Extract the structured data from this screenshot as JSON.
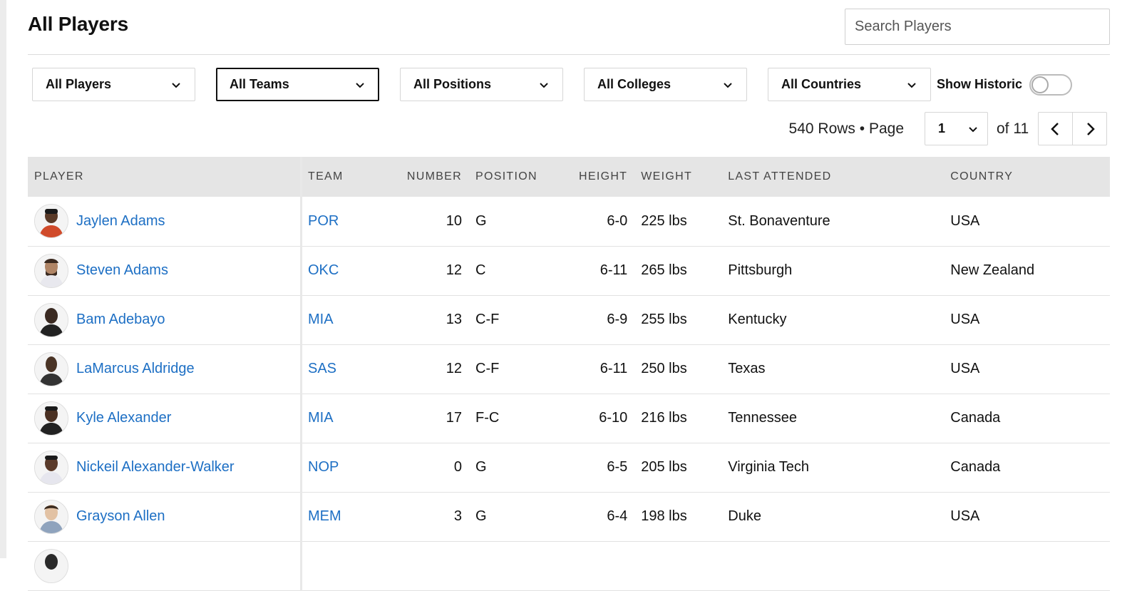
{
  "title": "All Players",
  "search": {
    "placeholder": "Search Players"
  },
  "filters": [
    {
      "label": "All Players",
      "active": false
    },
    {
      "label": "All Teams",
      "active": true
    },
    {
      "label": "All Positions",
      "active": false
    },
    {
      "label": "All Colleges",
      "active": false
    },
    {
      "label": "All Countries",
      "active": false
    }
  ],
  "historic": {
    "label": "Show Historic",
    "on": false
  },
  "pagination": {
    "rows_label": "540 Rows • Page",
    "current_page": "1",
    "of_label": "of 11"
  },
  "table": {
    "columns": [
      "PLAYER",
      "TEAM",
      "NUMBER",
      "POSITION",
      "HEIGHT",
      "WEIGHT",
      "LAST ATTENDED",
      "COUNTRY"
    ],
    "rows": [
      {
        "player": "Jaylen Adams",
        "team": "POR",
        "number": "10",
        "position": "G",
        "height": "6-0",
        "weight": "225 lbs",
        "last_attended": "St. Bonaventure",
        "country": "USA"
      },
      {
        "player": "Steven Adams",
        "team": "OKC",
        "number": "12",
        "position": "C",
        "height": "6-11",
        "weight": "265 lbs",
        "last_attended": "Pittsburgh",
        "country": "New Zealand"
      },
      {
        "player": "Bam Adebayo",
        "team": "MIA",
        "number": "13",
        "position": "C-F",
        "height": "6-9",
        "weight": "255 lbs",
        "last_attended": "Kentucky",
        "country": "USA"
      },
      {
        "player": "LaMarcus Aldridge",
        "team": "SAS",
        "number": "12",
        "position": "C-F",
        "height": "6-11",
        "weight": "250 lbs",
        "last_attended": "Texas",
        "country": "USA"
      },
      {
        "player": "Kyle Alexander",
        "team": "MIA",
        "number": "17",
        "position": "F-C",
        "height": "6-10",
        "weight": "216 lbs",
        "last_attended": "Tennessee",
        "country": "Canada"
      },
      {
        "player": "Nickeil Alexander-Walker",
        "team": "NOP",
        "number": "0",
        "position": "G",
        "height": "6-5",
        "weight": "205 lbs",
        "last_attended": "Virginia Tech",
        "country": "Canada"
      },
      {
        "player": "Grayson Allen",
        "team": "MEM",
        "number": "3",
        "position": "G",
        "height": "6-4",
        "weight": "198 lbs",
        "last_attended": "Duke",
        "country": "USA"
      },
      {
        "player": "",
        "team": "",
        "number": "",
        "position": "",
        "height": "",
        "weight": "",
        "last_attended": "",
        "country": ""
      }
    ]
  }
}
